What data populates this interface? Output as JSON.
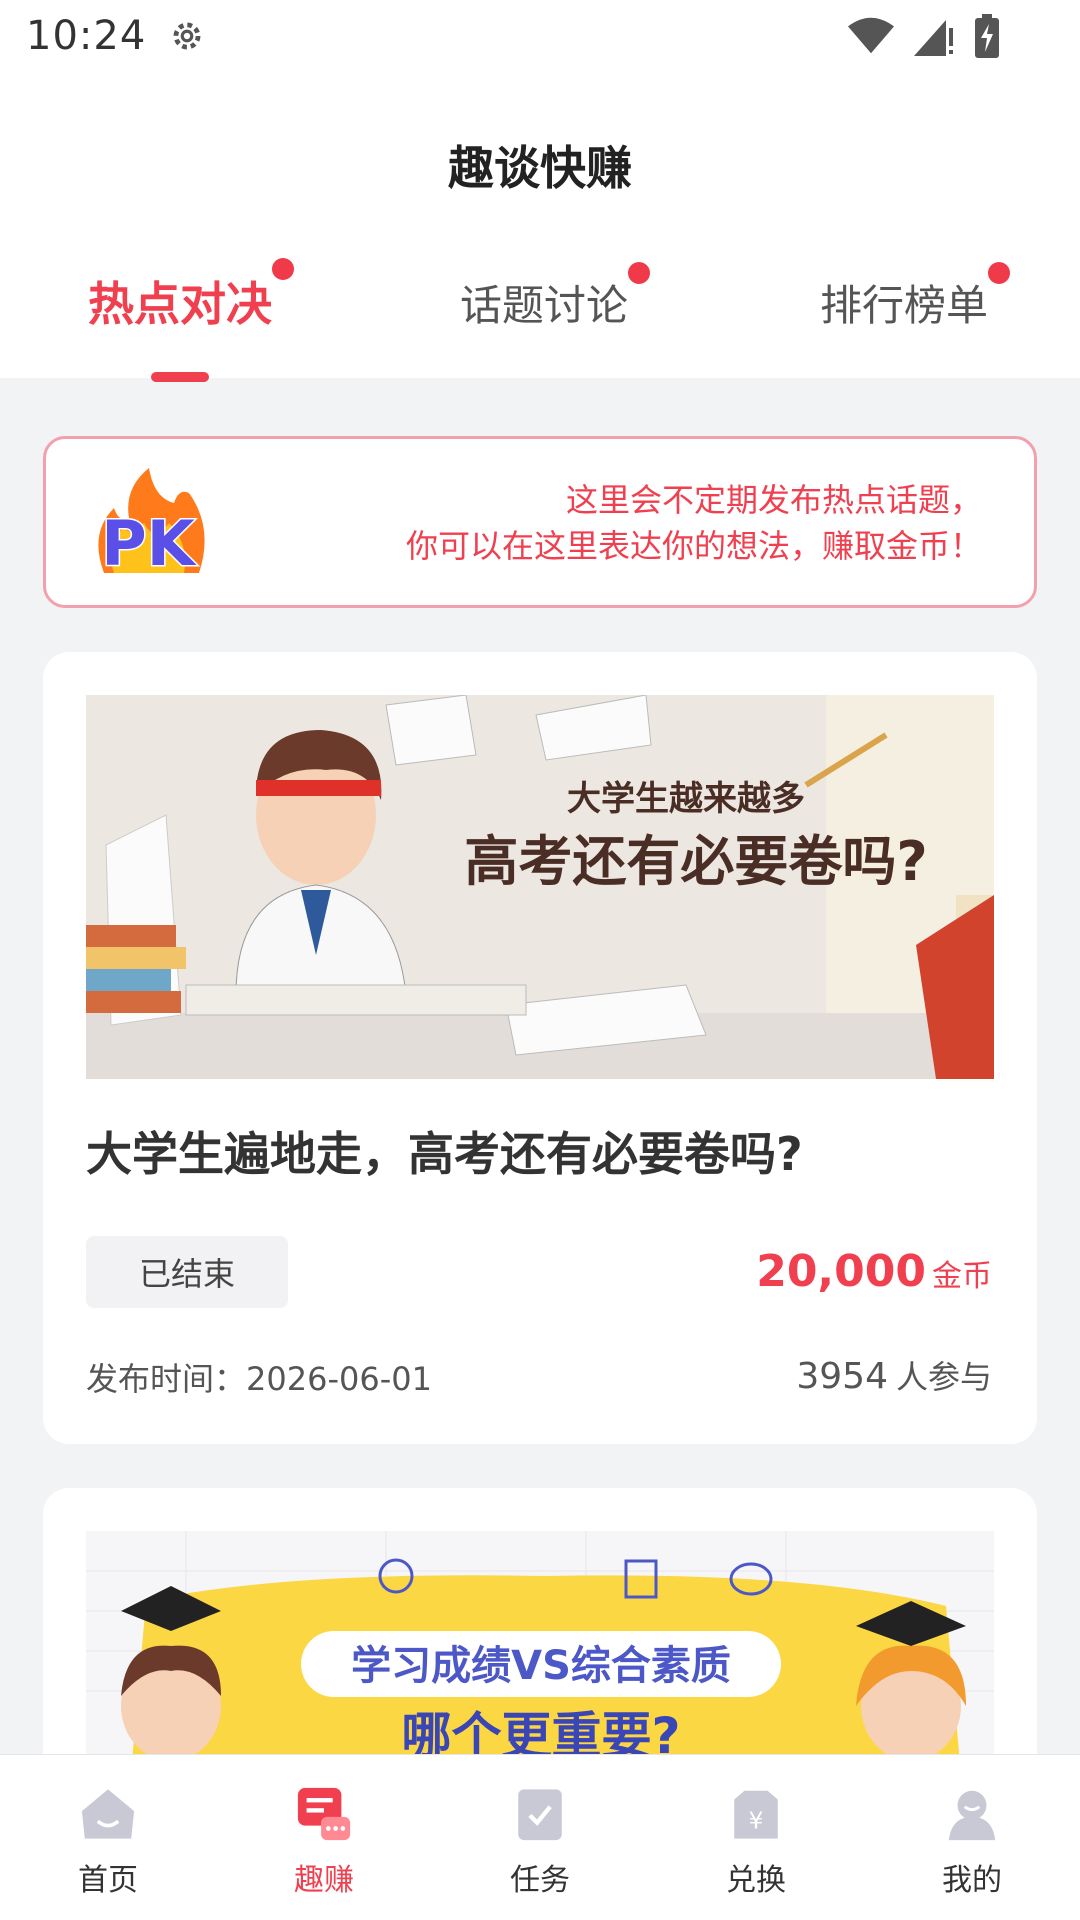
{
  "status_bar": {
    "time": "10:24"
  },
  "header": {
    "title": "趣谈快赚"
  },
  "tabs": [
    {
      "label": "热点对决",
      "active": true,
      "badge": true
    },
    {
      "label": "话题讨论",
      "active": false,
      "badge": true
    },
    {
      "label": "排行榜单",
      "active": false,
      "badge": true
    }
  ],
  "notice": {
    "logo_text": "PK",
    "line1": "这里会不定期发布热点话题，",
    "line2": "你可以在这里表达你的想法，赚取金币！"
  },
  "cards": [
    {
      "banner_subtitle": "大学生越来越多",
      "banner_title": "高考还有必要卷吗?",
      "title": "大学生遍地走，高考还有必要卷吗?",
      "status": "已结束",
      "reward_amount": "20,000",
      "reward_unit": "金币",
      "publish_time": "发布时间：2026-06-01",
      "participants_count": "3954",
      "participants_label": "人参与"
    },
    {
      "banner_title": "学习成绩VS综合素质",
      "banner_subtitle": "哪个更重要?"
    }
  ],
  "bottom_nav": [
    {
      "label": "首页",
      "icon": "home-icon",
      "active": false
    },
    {
      "label": "趣赚",
      "icon": "chat-icon",
      "active": true
    },
    {
      "label": "任务",
      "icon": "task-icon",
      "active": false
    },
    {
      "label": "兑换",
      "icon": "exchange-icon",
      "active": false
    },
    {
      "label": "我的",
      "icon": "profile-icon",
      "active": false
    }
  ],
  "colors": {
    "accent": "#f04050",
    "background": "#f2f3f5",
    "icon_inactive": "#c9c9d6"
  }
}
